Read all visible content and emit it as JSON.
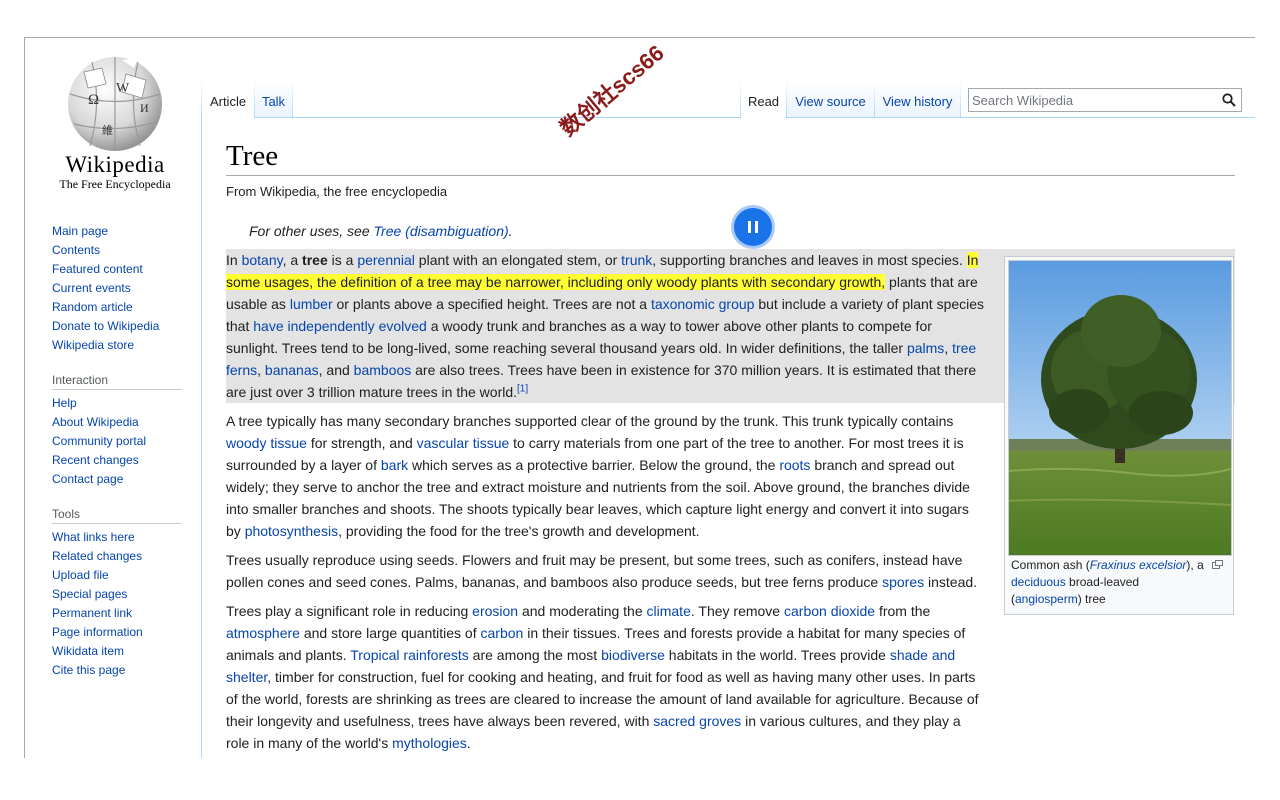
{
  "logo": {
    "wordmark": "Wikipedia",
    "tagline": "The Free Encyclopedia"
  },
  "watermark": "数创社scs66",
  "sidebar": {
    "navigation": [
      "Main page",
      "Contents",
      "Featured content",
      "Current events",
      "Random article",
      "Donate to Wikipedia",
      "Wikipedia store"
    ],
    "interaction_heading": "Interaction",
    "interaction": [
      "Help",
      "About Wikipedia",
      "Community portal",
      "Recent changes",
      "Contact page"
    ],
    "tools_heading": "Tools",
    "tools": [
      "What links here",
      "Related changes",
      "Upload file",
      "Special pages",
      "Permanent link",
      "Page information",
      "Wikidata item",
      "Cite this page"
    ]
  },
  "tabs": {
    "article": "Article",
    "talk": "Talk",
    "read": "Read",
    "view_source": "View source",
    "view_history": "View history"
  },
  "search": {
    "placeholder": "Search Wikipedia",
    "value": ""
  },
  "article": {
    "title": "Tree",
    "tagline": "From Wikipedia, the free encyclopedia",
    "hatnote_prefix": "For other uses, see ",
    "hatnote_link": "Tree (disambiguation)",
    "hatnote_suffix": ".",
    "reference_marker": "[1]",
    "p1": {
      "t1": "In ",
      "botany": "botany",
      "t2": ", a ",
      "tree": "tree",
      "t3": " is a ",
      "perennial": "perennial",
      "t4": " plant with an elongated stem, or ",
      "trunk": "trunk",
      "t5": ", supporting branches and leaves in most species. ",
      "highlight": "In some usages, the definition of a tree may be narrower, including only woody plants with secondary growth,",
      "t6": " plants that are usable as ",
      "lumber": "lumber",
      "t7": " or plants above a specified height. Trees are not a ",
      "taxonomic_group": "taxonomic group",
      "t8": " but include a variety of plant species that ",
      "have_independently_evolved": "have independently evolved",
      "t9": " a woody trunk and branches as a way to tower above other plants to compete for sunlight. Trees tend to be long-lived, some reaching several thousand years old. In wider definitions, the taller ",
      "palms": "palms",
      "t10": ", ",
      "tree_ferns": "tree ferns",
      "t11": ", ",
      "bananas": "bananas",
      "t12": ", and ",
      "bamboos": "bamboos",
      "t13": " are also trees. Trees have been in existence for 370 million years. It is estimated that there are just over 3 trillion mature trees in the world."
    },
    "p2": {
      "t1": "A tree typically has many secondary branches supported clear of the ground by the trunk. This trunk typically contains ",
      "woody_tissue": "woody tissue",
      "t2": " for strength, and ",
      "vascular_tissue": "vascular tissue",
      "t3": " to carry materials from one part of the tree to another. For most trees it is surrounded by a layer of ",
      "bark": "bark",
      "t4": " which serves as a protective barrier. Below the ground, the ",
      "roots": "roots",
      "t5": " branch and spread out widely; they serve to anchor the tree and extract moisture and nutrients from the soil. Above ground, the branches divide into smaller branches and shoots. The shoots typically bear leaves, which capture light energy and convert it into sugars by ",
      "photosynthesis": "photosynthesis",
      "t6": ", providing the food for the tree's growth and development."
    },
    "p3": {
      "t1": "Trees usually reproduce using seeds. Flowers and fruit may be present, but some trees, such as conifers, instead have pollen cones and seed cones. Palms, bananas, and bamboos also produce seeds, but tree ferns produce ",
      "spores": "spores",
      "t2": " instead."
    },
    "p4": {
      "t1": "Trees play a significant role in reducing ",
      "erosion": "erosion",
      "t2": " and moderating the ",
      "climate": "climate",
      "t3": ". They remove ",
      "carbon_dioxide": "carbon dioxide",
      "t4": " from the ",
      "atmosphere": "atmosphere",
      "t5": " and store large quantities of ",
      "carbon": "carbon",
      "t6": " in their tissues. Trees and forests provide a habitat for many species of animals and plants. ",
      "tropical_rainforests": "Tropical rainforests",
      "t7": " are among the most ",
      "biodiverse": "biodiverse",
      "t8": " habitats in the world. Trees provide ",
      "shade_and_shelter": "shade and shelter",
      "t9": ", timber for construction, fuel for cooking and heating, and fruit for food as well as having many other uses. In parts of the world, forests are shrinking as trees are cleared to increase the amount of land available for agriculture. Because of their longevity and usefulness, trees have always been revered, with ",
      "sacred_groves": "sacred groves",
      "t10": " in various cultures, and they play a role in many of the world's ",
      "mythologies": "mythologies",
      "t11": "."
    }
  },
  "infobox": {
    "caption_prefix": "Common ash (",
    "caption_species": "Fraxinus excelsior",
    "caption_mid1": "), a ",
    "caption_deciduous": "deciduous",
    "caption_mid2": " broad-leaved (",
    "caption_angiosperm": "angiosperm",
    "caption_suffix": ") tree"
  },
  "colors": {
    "link": "#0645ad",
    "highlight": "#ffff33",
    "reading_bg": "#e3e3e3",
    "player": "#1a73e8"
  }
}
